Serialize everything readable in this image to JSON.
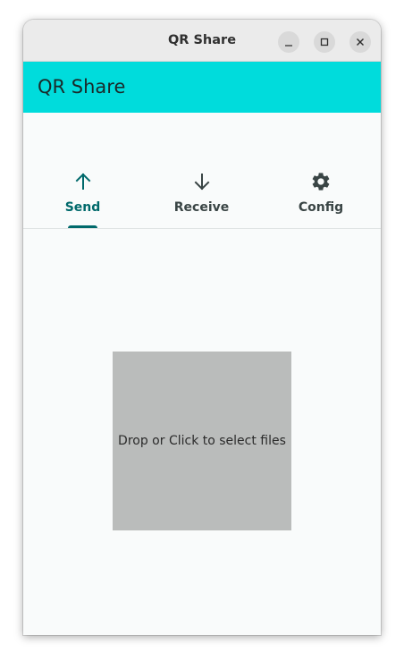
{
  "window": {
    "title": "QR Share"
  },
  "appbar": {
    "title": "QR Share",
    "color": "#00dcdc"
  },
  "tabs": [
    {
      "label": "Send",
      "icon": "arrow-up-icon",
      "selected": true
    },
    {
      "label": "Receive",
      "icon": "arrow-down-icon",
      "selected": false
    },
    {
      "label": "Config",
      "icon": "gear-icon",
      "selected": false
    }
  ],
  "accent_color": "#00696b",
  "dropzone": {
    "text": "Drop or Click to select files"
  }
}
